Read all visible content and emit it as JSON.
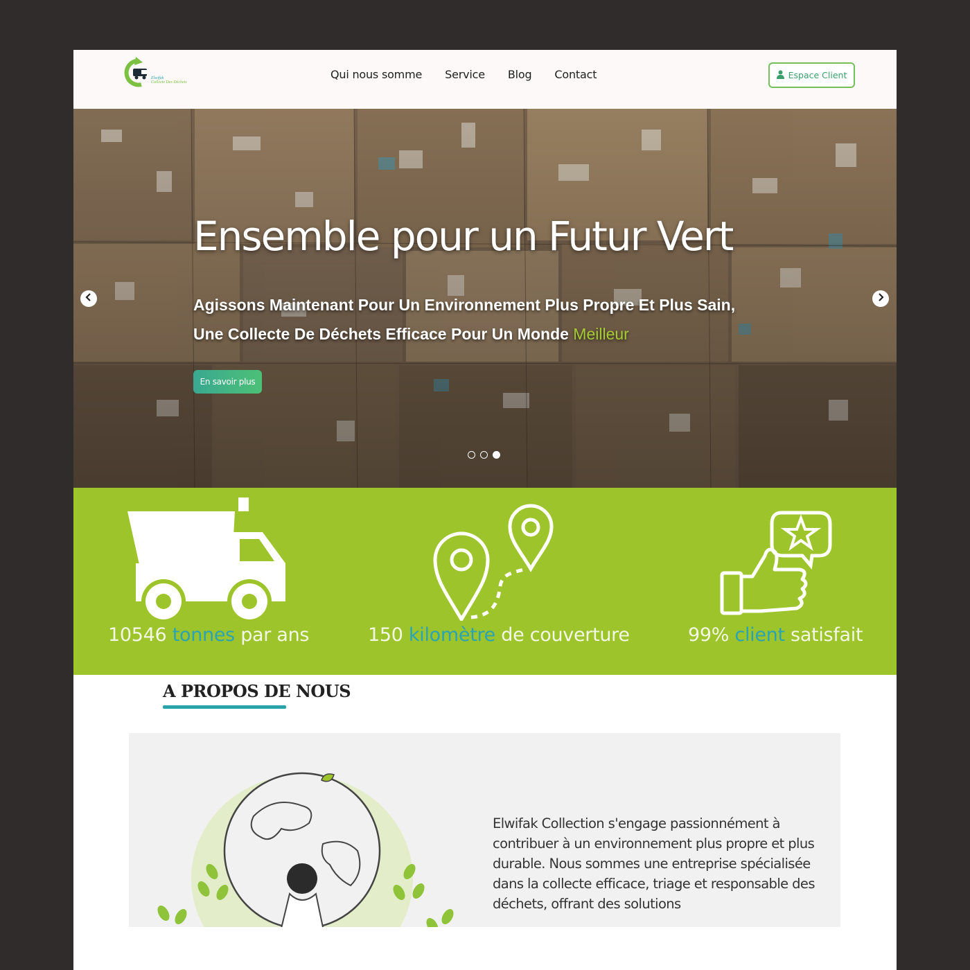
{
  "header": {
    "logo_text_line1": "Elwifak",
    "logo_text_line2": "Collecte Des Déchets",
    "nav": [
      "Qui nous somme",
      "Service",
      "Blog",
      "Contact"
    ],
    "client_button": "Espace Client"
  },
  "hero": {
    "title": "Ensemble pour un Futur Vert",
    "subtitle_line1": "Agissons Maintenant Pour Un Environnement Plus Propre Et Plus Sain,",
    "subtitle_line2": "Une Collecte De Déchets Efficace Pour Un Monde ",
    "subtitle_highlight": "Meilleur",
    "cta": "En savoir plus",
    "slides": 3,
    "active_slide": 3
  },
  "stats": [
    {
      "number": "10546 ",
      "accent": "tonnes",
      "rest": " par ans",
      "icon": "dump-truck-icon"
    },
    {
      "number": "150 ",
      "accent": "kilomètre",
      "rest": "  de couverture",
      "icon": "route-pins-icon"
    },
    {
      "number": "99% ",
      "accent": "client",
      "rest": "  satisfait",
      "icon": "thumbs-up-star-icon"
    }
  ],
  "about": {
    "title": "A PROPOS DE NOUS",
    "text": "Elwifak Collection s'engage passionnément à contribuer à un environnement plus propre et plus durable. Nous sommes une entreprise spécialisée dans la collecte efficace, triage et responsable des déchets, offrant des solutions"
  },
  "colors": {
    "stats_bg": "#9dc42a",
    "accent_teal": "#2aa3b5",
    "button_green": "#3aa890",
    "page_bg": "#302c2b"
  }
}
